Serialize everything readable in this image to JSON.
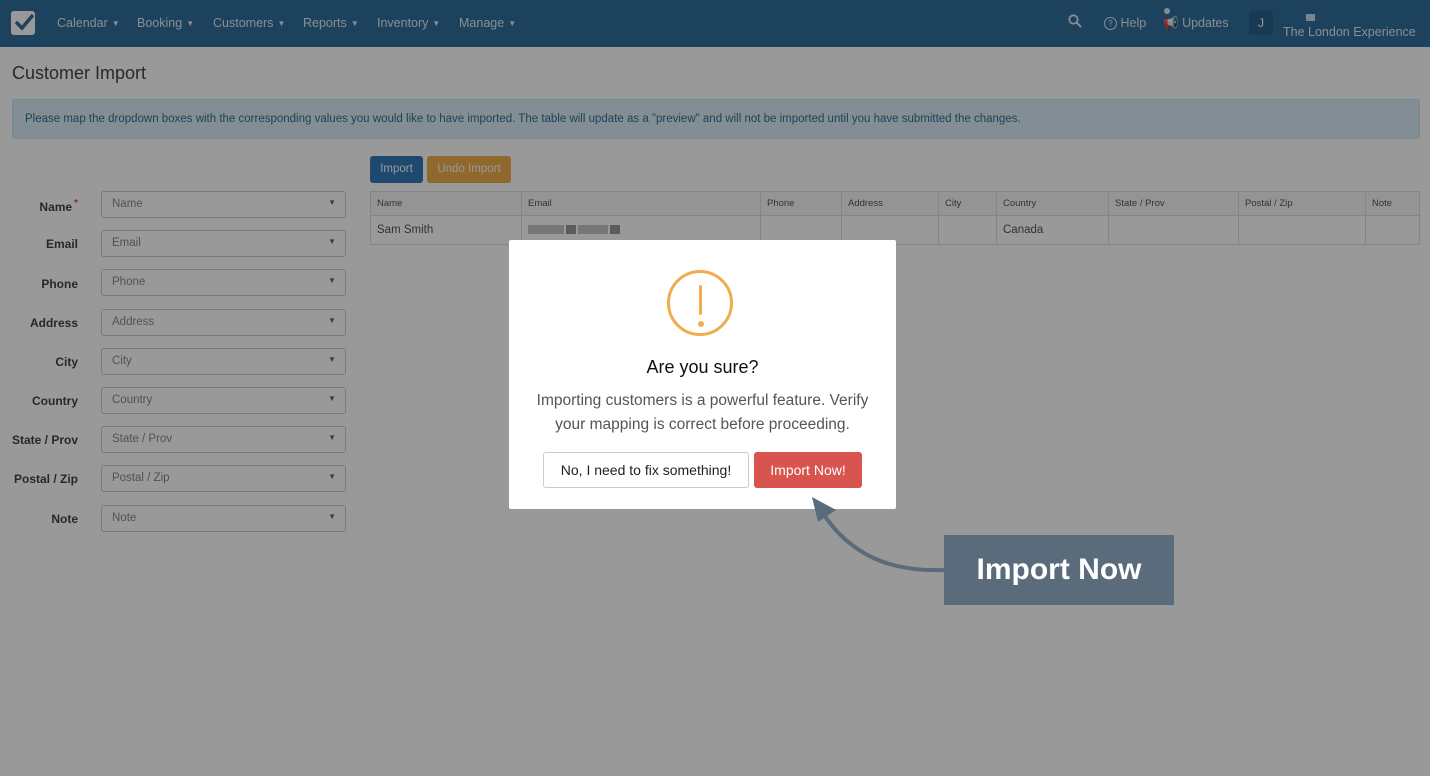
{
  "navbar": {
    "menu": [
      "Calendar",
      "Booking",
      "Customers",
      "Reports",
      "Inventory",
      "Manage"
    ],
    "help_label": "Help",
    "updates_label": "Updates",
    "avatar_initial": "J",
    "company_name": "The London Experience"
  },
  "page": {
    "title": "Customer Import",
    "info_text": "Please map the dropdown boxes with the corresponding values you would like to have imported. The table will update as a \"preview\" and will not be imported until you have submitted the changes."
  },
  "mapping_fields": [
    {
      "label": "Name",
      "value": "Name",
      "required": true
    },
    {
      "label": "Email",
      "value": "Email"
    },
    {
      "label": "Phone",
      "value": "Phone"
    },
    {
      "label": "Address",
      "value": "Address"
    },
    {
      "label": "City",
      "value": "City"
    },
    {
      "label": "Country",
      "value": "Country"
    },
    {
      "label": "State / Prov",
      "value": "State / Prov"
    },
    {
      "label": "Postal / Zip",
      "value": "Postal / Zip"
    },
    {
      "label": "Note",
      "value": "Note"
    }
  ],
  "actions": {
    "import_label": "Import",
    "undo_label": "Undo Import"
  },
  "preview_table": {
    "columns": [
      "Name",
      "Email",
      "Phone",
      "Address",
      "City",
      "Country",
      "State / Prov",
      "Postal / Zip",
      "Note"
    ],
    "rows": [
      [
        "Sam Smith",
        "",
        "",
        "",
        "",
        "Canada",
        "",
        "",
        ""
      ]
    ]
  },
  "modal": {
    "icon": "warning-icon",
    "title": "Are you sure?",
    "line1": "Importing customers is a powerful feature. Verify",
    "line2": "your mapping is correct before proceeding.",
    "cancel_label": "No, I need to fix something!",
    "confirm_label": "Import Now!"
  },
  "annotation": {
    "label": "Import Now"
  },
  "colors": {
    "navbar": "#2f6f9c",
    "primary": "#337ab7",
    "warning": "#f0ad4e",
    "danger": "#d9534f",
    "callout": "#5a6b7c"
  }
}
